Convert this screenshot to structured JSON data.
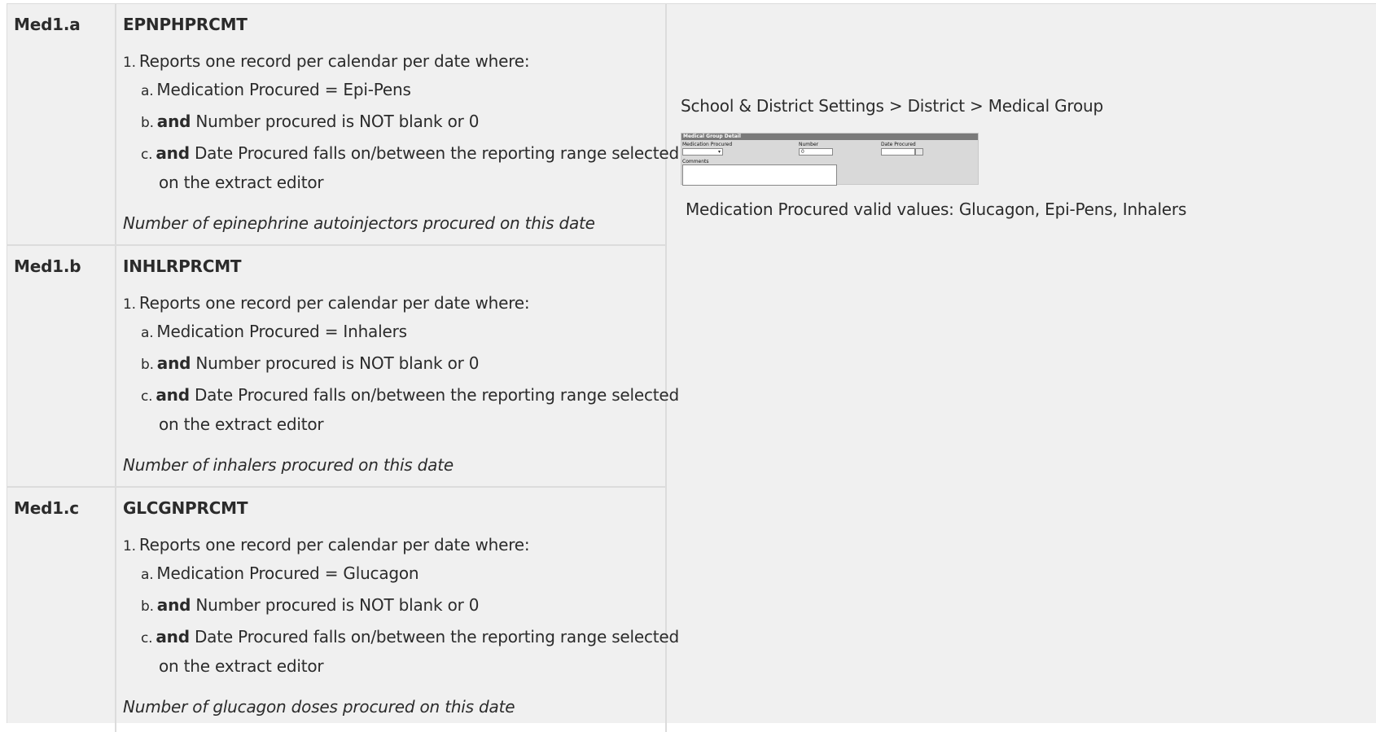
{
  "rows": [
    {
      "id": "Med1.a",
      "code": "EPNPHPRCMT",
      "intro": "Reports one record per calendar per date where:",
      "intro_marker": "1.",
      "a_marker": "a.",
      "a_text": "Medication Procured = Epi-Pens",
      "b_marker": "b.",
      "b_bold": "and",
      "b_text": " Number procured is NOT blank or 0",
      "c_marker": "c.",
      "c_bold": "and",
      "c_text": " Date Procured falls on/between the reporting range selected",
      "c_text2": "on the extract editor",
      "note": "Number of epinephrine autoinjectors procured on this date"
    },
    {
      "id": "Med1.b",
      "code": "INHLRPRCMT",
      "intro": "Reports one record per calendar per date where:",
      "intro_marker": "1.",
      "a_marker": "a.",
      "a_text": "Medication Procured = Inhalers",
      "b_marker": "b.",
      "b_bold": "and",
      "b_text": " Number procured is NOT blank or 0",
      "c_marker": "c.",
      "c_bold": "and",
      "c_text": " Date Procured falls on/between the reporting range selected",
      "c_text2": "on the extract editor",
      "note": "Number of inhalers procured on this date"
    },
    {
      "id": "Med1.c",
      "code": "GLCGNPRCMT",
      "intro": "Reports one record per calendar per date where:",
      "intro_marker": "1.",
      "a_marker": "a.",
      "a_text": "Medication Procured = Glucagon",
      "b_marker": "b.",
      "b_bold": "and",
      "b_text": " Number procured is NOT blank or 0",
      "c_marker": "c.",
      "c_bold": "and",
      "c_text": " Date Procured falls on/between the reporting range selected",
      "c_text2": "on the extract editor",
      "note": "Number of glucagon doses procured on this date"
    }
  ],
  "location": {
    "path": "School & District Settings > District > Medical Group",
    "valid_values": "Medication Procured valid values: Glucagon, Epi-Pens, Inhalers"
  },
  "embedded_screenshot": {
    "header": "Medical Group Detail",
    "medication_label": "Medication Procured",
    "number_label": "Number",
    "number_value": "0",
    "date_label": "Date Procured",
    "comments_label": "Comments"
  }
}
